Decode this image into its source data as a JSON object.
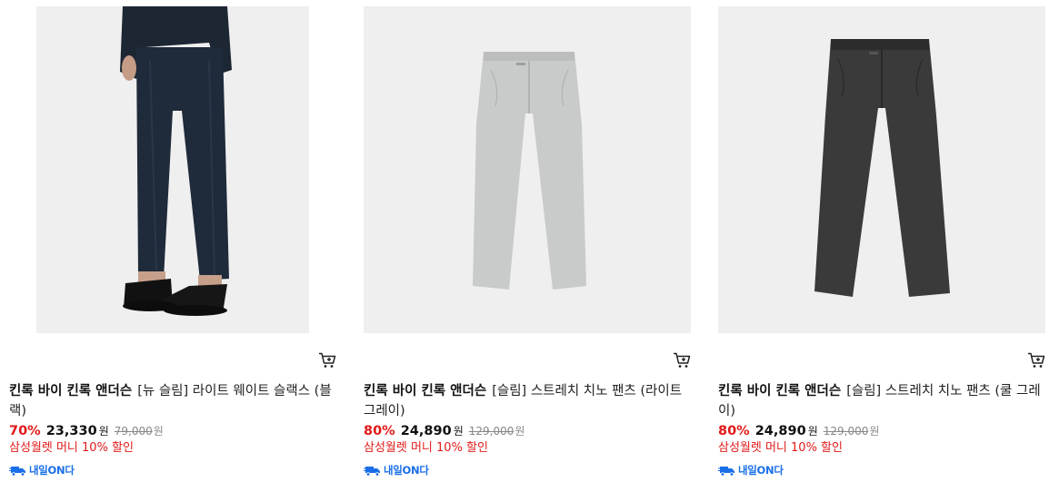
{
  "products": [
    {
      "brand": "킨록 바이 킨록 앤더슨",
      "name": "[뉴 슬림] 라이트 웨이트 슬랙스 (블랙)",
      "discount": "70%",
      "price": "23,330",
      "currency": "원",
      "original_price": "79,000",
      "original_currency": "원",
      "promo": "삼성월렛 머니 10% 할인",
      "delivery_badge": "내일ON다",
      "image_icon": "model-wearing-pants-image"
    },
    {
      "brand": "킨록 바이 킨록 앤더슨",
      "name": "[슬림] 스트레치 치노 팬츠 (라이트 그레이)",
      "discount": "80%",
      "price": "24,890",
      "currency": "원",
      "original_price": "129,000",
      "original_currency": "원",
      "promo": "삼성월렛 머니 10% 할인",
      "delivery_badge": "내일ON다",
      "image_icon": "grey-chino-pants-image"
    },
    {
      "brand": "킨록 바이 킨록 앤더슨",
      "name": "[슬림] 스트레치 치노 팬츠 (쿨 그레이)",
      "discount": "80%",
      "price": "24,890",
      "currency": "원",
      "original_price": "129,000",
      "original_currency": "원",
      "promo": "삼성월렛 머니 10% 할인",
      "delivery_badge": "내일ON다",
      "image_icon": "charcoal-chino-pants-image"
    }
  ],
  "colors": {
    "discount": "#e11a1a",
    "promo": "#e11a1a",
    "delivery": "#1a6fe8",
    "original_price": "#888888"
  }
}
